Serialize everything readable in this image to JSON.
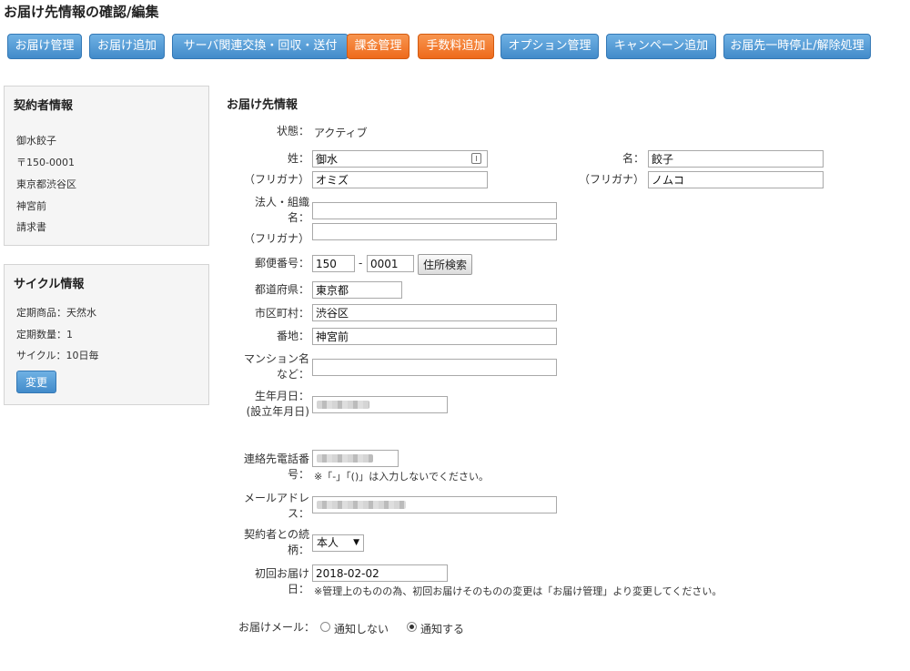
{
  "page_title": "お届け先情報の確認/編集",
  "toolbar": [
    {
      "label": "お届け管理",
      "color": "#428bca"
    },
    {
      "label": "お届け追加",
      "color": "#428bca"
    },
    {
      "label": "サーバ関連交換・回収・送付",
      "color": "#428bca"
    },
    {
      "label": "課金管理",
      "color": "#ee6a1b"
    },
    {
      "label": "手数料追加",
      "color": "#ee6a1b"
    },
    {
      "label": "オプション管理",
      "color": "#428bca"
    },
    {
      "label": "キャンペーン追加",
      "color": "#428bca"
    },
    {
      "label": "お届先一時停止/解除処理",
      "color": "#428bca"
    }
  ],
  "contractor": {
    "title": "契約者情報",
    "name": "御水餃子",
    "postal": "〒150-0001",
    "address1": "東京都渋谷区",
    "address2": "神宮前",
    "billing": "請求書"
  },
  "cycle": {
    "title": "サイクル情報",
    "product": "定期商品：天然水",
    "quantity": "定期数量：1",
    "cycle": "サイクル：10日毎",
    "change_label": "変更"
  },
  "form": {
    "section_title": "お届け先情報",
    "status_label": "状態：",
    "status_value": "アクティブ",
    "last_name_label": "姓：",
    "last_name_value": "御水",
    "first_name_label": "名：",
    "first_name_value": "餃子",
    "kana_label": "（フリガナ）",
    "last_kana_value": "オミズ",
    "first_kana_value": "ノムコ",
    "corp_label_1": "法人・組織",
    "corp_label_2": "名：",
    "corp_value": "",
    "corp_kana_value": "",
    "zip_label": "郵便番号：",
    "zip1_value": "150",
    "zip_sep": "-",
    "zip2_value": "0001",
    "addr_search_label": "住所検索",
    "pref_label": "都道府県：",
    "pref_value": "東京都",
    "city_label": "市区町村：",
    "city_value": "渋谷区",
    "street_label": "番地：",
    "street_value": "神宮前",
    "building_label_1": "マンション名",
    "building_label_2": "など：",
    "building_value": "",
    "birth_label_1": "生年月日：",
    "birth_label_2": "(設立年月日)",
    "phone_label_1": "連絡先電話番",
    "phone_label_2": "号：",
    "phone_note": "※「-」「()」は入力しないでください。",
    "email_label_1": "メールアドレ",
    "email_label_2": "ス：",
    "relation_label_1": "契約者との続",
    "relation_label_2": "柄：",
    "relation_value": "本人",
    "first_delivery_label_1": "初回お届け",
    "first_delivery_label_2": "日：",
    "first_delivery_value": "2018-02-02",
    "first_delivery_note": "※管理上のものの為、初回お届けそのものの変更は「お届け管理」より変更してください。",
    "mail_label": "お届けメール：",
    "mail_off_label": "通知しない",
    "mail_on_label": "通知する"
  }
}
